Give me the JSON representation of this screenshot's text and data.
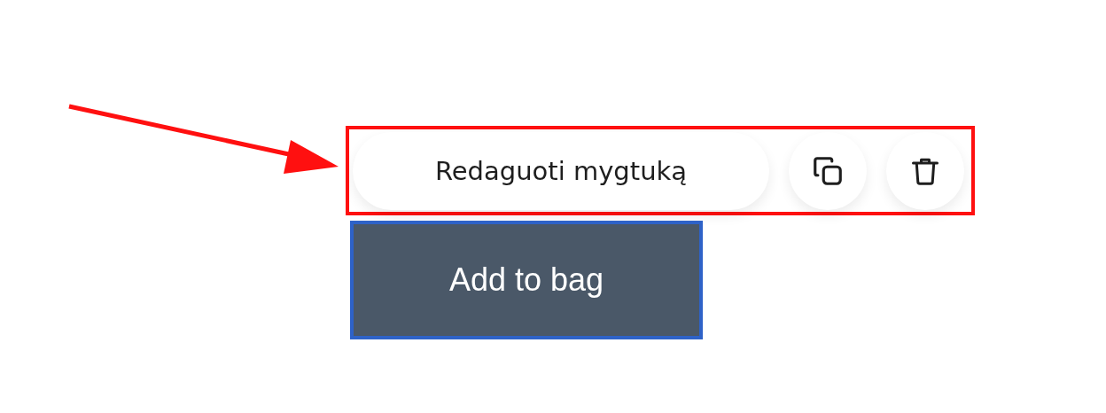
{
  "toolbar": {
    "edit_label": "Redaguoti mygtuką",
    "actions": [
      {
        "kind": "copy"
      },
      {
        "kind": "delete"
      }
    ]
  },
  "product_button": {
    "label": "Add to bag"
  }
}
